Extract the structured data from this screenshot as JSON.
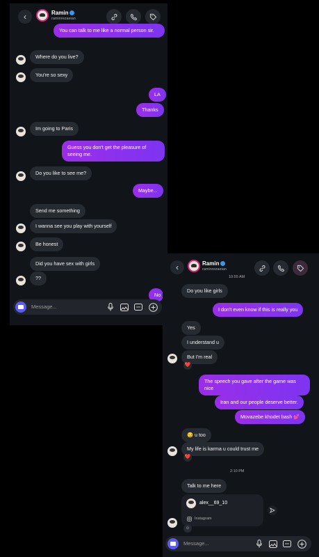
{
  "panel1": {
    "header": {
      "name": "Ramin",
      "handle": "raminrezaeian"
    },
    "messages": [
      {
        "id": "m1",
        "dir": "out",
        "text": "You can talk to me like a normal person sir."
      },
      {
        "id": "m2",
        "dir": "in",
        "text": "Where do you live?"
      },
      {
        "id": "m3",
        "dir": "in",
        "text": "You're so sexy"
      },
      {
        "id": "m4",
        "dir": "out",
        "text": "LA"
      },
      {
        "id": "m5",
        "dir": "out",
        "text": "Thanks"
      },
      {
        "id": "m6",
        "dir": "in",
        "text": "Im going to Paris"
      },
      {
        "id": "m7",
        "dir": "out",
        "text": "Guess you don't get the pleasure of seeing me."
      },
      {
        "id": "m8",
        "dir": "in",
        "text": "Do you like to see me?"
      },
      {
        "id": "m9",
        "dir": "out",
        "text": "Maybe..."
      },
      {
        "id": "m10",
        "dir": "in",
        "text": "Send me something"
      },
      {
        "id": "m11",
        "dir": "in",
        "text": "I wanna see you play with yourself"
      },
      {
        "id": "m12",
        "dir": "in",
        "text": "Be honest"
      },
      {
        "id": "m13",
        "dir": "in",
        "text": "Did you have sex with girls"
      },
      {
        "id": "m14",
        "dir": "in",
        "text": "??"
      },
      {
        "id": "m15",
        "dir": "out",
        "text": "No"
      }
    ],
    "input_placeholder": "Message..."
  },
  "panel2": {
    "header": {
      "name": "Ramin",
      "handle": "raminrezaeian"
    },
    "timestamps": [
      "10:55 AM",
      "2:10 PM"
    ],
    "messages": [
      {
        "id": "n1",
        "dir": "in",
        "text": "Do you like girls"
      },
      {
        "id": "n2",
        "dir": "out",
        "text": "I don't even know if this is really you"
      },
      {
        "id": "n3",
        "dir": "in",
        "text": "Yes"
      },
      {
        "id": "n4",
        "dir": "in",
        "text": "I understand u"
      },
      {
        "id": "n5",
        "dir": "in",
        "text": "But I'm real"
      },
      {
        "id": "n6",
        "dir": "out",
        "text": "The speech you gave after the game was nice"
      },
      {
        "id": "n7",
        "dir": "out",
        "text": "Iran and our people deserve better."
      },
      {
        "id": "n8",
        "dir": "out",
        "text": "Movazebe khodet bash 💕"
      },
      {
        "id": "n9",
        "dir": "in",
        "text": "😏 u too"
      },
      {
        "id": "n10",
        "dir": "in",
        "text": "My life is karma u could trust me"
      },
      {
        "id": "n11",
        "dir": "in",
        "text": "Talk to me here"
      }
    ],
    "reaction": "❤️",
    "share": {
      "username": "alex__69_10",
      "platform": "Instagram"
    },
    "input_placeholder": "Message..."
  }
}
